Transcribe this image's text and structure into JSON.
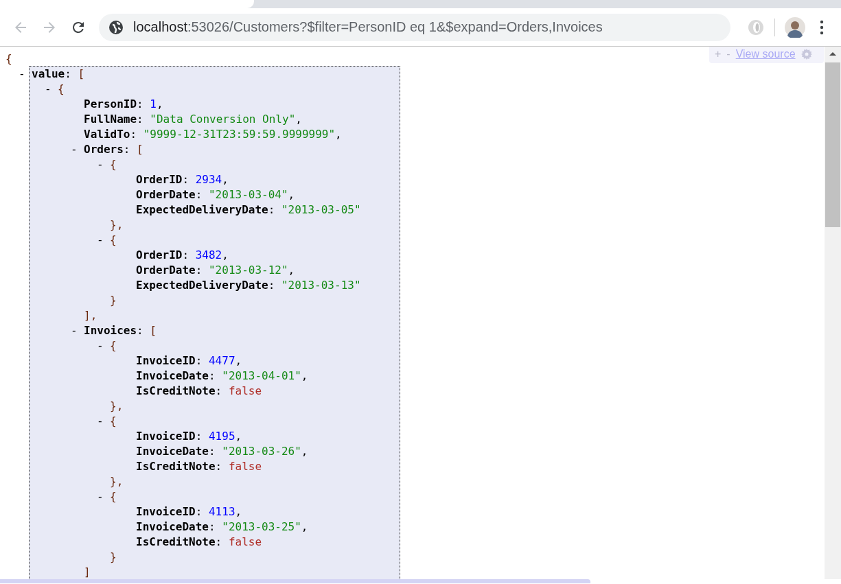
{
  "browser": {
    "url_host": "localhost",
    "url_rest": ":53026/Customers?$filter=PersonID eq 1&$expand=Orders,Invoices",
    "back_disabled": true,
    "forward_disabled": true
  },
  "viewer_toolbar": {
    "expand": "+",
    "collapse": "-",
    "link": "View source"
  },
  "document": {
    "key_separator": ":",
    "open": "{",
    "children": [
      {
        "toggle": "-",
        "key": "value",
        "open": "[",
        "highlighted": true,
        "children": [
          {
            "toggle": "-",
            "open": "{",
            "children": [
              {
                "key": "PersonID",
                "value": "1",
                "kind": "number",
                "trail": ","
              },
              {
                "key": "FullName",
                "value": "\"Data Conversion Only\"",
                "kind": "string",
                "trail": ","
              },
              {
                "key": "ValidTo",
                "value": "\"9999-12-31T23:59:59.9999999\"",
                "kind": "string",
                "trail": ","
              },
              {
                "toggle": "-",
                "key": "Orders",
                "open": "[",
                "close": "],",
                "children": [
                  {
                    "toggle": "-",
                    "open": "{",
                    "close": "},",
                    "children": [
                      {
                        "key": "OrderID",
                        "value": "2934",
                        "kind": "number",
                        "trail": ","
                      },
                      {
                        "key": "OrderDate",
                        "value": "\"2013-03-04\"",
                        "kind": "string",
                        "trail": ","
                      },
                      {
                        "key": "ExpectedDeliveryDate",
                        "value": "\"2013-03-05\"",
                        "kind": "string"
                      }
                    ]
                  },
                  {
                    "toggle": "-",
                    "open": "{",
                    "close": "}",
                    "children": [
                      {
                        "key": "OrderID",
                        "value": "3482",
                        "kind": "number",
                        "trail": ","
                      },
                      {
                        "key": "OrderDate",
                        "value": "\"2013-03-12\"",
                        "kind": "string",
                        "trail": ","
                      },
                      {
                        "key": "ExpectedDeliveryDate",
                        "value": "\"2013-03-13\"",
                        "kind": "string"
                      }
                    ]
                  }
                ]
              },
              {
                "toggle": "-",
                "key": "Invoices",
                "open": "[",
                "close": "]",
                "children": [
                  {
                    "toggle": "-",
                    "open": "{",
                    "close": "},",
                    "children": [
                      {
                        "key": "InvoiceID",
                        "value": "4477",
                        "kind": "number",
                        "trail": ","
                      },
                      {
                        "key": "InvoiceDate",
                        "value": "\"2013-04-01\"",
                        "kind": "string",
                        "trail": ","
                      },
                      {
                        "key": "IsCreditNote",
                        "value": "false",
                        "kind": "boolean"
                      }
                    ]
                  },
                  {
                    "toggle": "-",
                    "open": "{",
                    "close": "},",
                    "children": [
                      {
                        "key": "InvoiceID",
                        "value": "4195",
                        "kind": "number",
                        "trail": ","
                      },
                      {
                        "key": "InvoiceDate",
                        "value": "\"2013-03-26\"",
                        "kind": "string",
                        "trail": ","
                      },
                      {
                        "key": "IsCreditNote",
                        "value": "false",
                        "kind": "boolean"
                      }
                    ]
                  },
                  {
                    "toggle": "-",
                    "open": "{",
                    "close": "}",
                    "children": [
                      {
                        "key": "InvoiceID",
                        "value": "4113",
                        "kind": "number",
                        "trail": ","
                      },
                      {
                        "key": "InvoiceDate",
                        "value": "\"2013-03-25\"",
                        "kind": "string",
                        "trail": ","
                      },
                      {
                        "key": "IsCreditNote",
                        "value": "false",
                        "kind": "boolean"
                      }
                    ]
                  }
                ]
              }
            ]
          }
        ]
      }
    ]
  }
}
